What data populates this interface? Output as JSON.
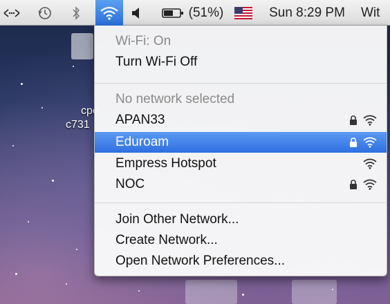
{
  "menubar": {
    "wifi_status_text": "(51%)",
    "clock": "Sun 8:29 PM",
    "truncated_right": "Wit",
    "icons": [
      "network-arrows-icon",
      "time-machine-icon",
      "bluetooth-icon",
      "wifi-icon",
      "volume-icon",
      "battery-icon",
      "us-flag-icon"
    ]
  },
  "desktop": {
    "label_line1": "cpe",
    "label_line2": "c731"
  },
  "wifi_menu": {
    "status": "Wi-Fi: On",
    "toggle": "Turn Wi-Fi Off",
    "no_network": "No network selected",
    "networks": [
      {
        "name": "APAN33",
        "locked": true,
        "selected": false
      },
      {
        "name": "Eduroam",
        "locked": true,
        "selected": true
      },
      {
        "name": "Empress Hotspot",
        "locked": false,
        "selected": false
      },
      {
        "name": "NOC",
        "locked": true,
        "selected": false
      }
    ],
    "join_other": "Join Other Network...",
    "create": "Create Network...",
    "preferences": "Open Network Preferences..."
  },
  "colors": {
    "highlight": "#2f6fe0",
    "menubar": "#e6e6e6"
  }
}
